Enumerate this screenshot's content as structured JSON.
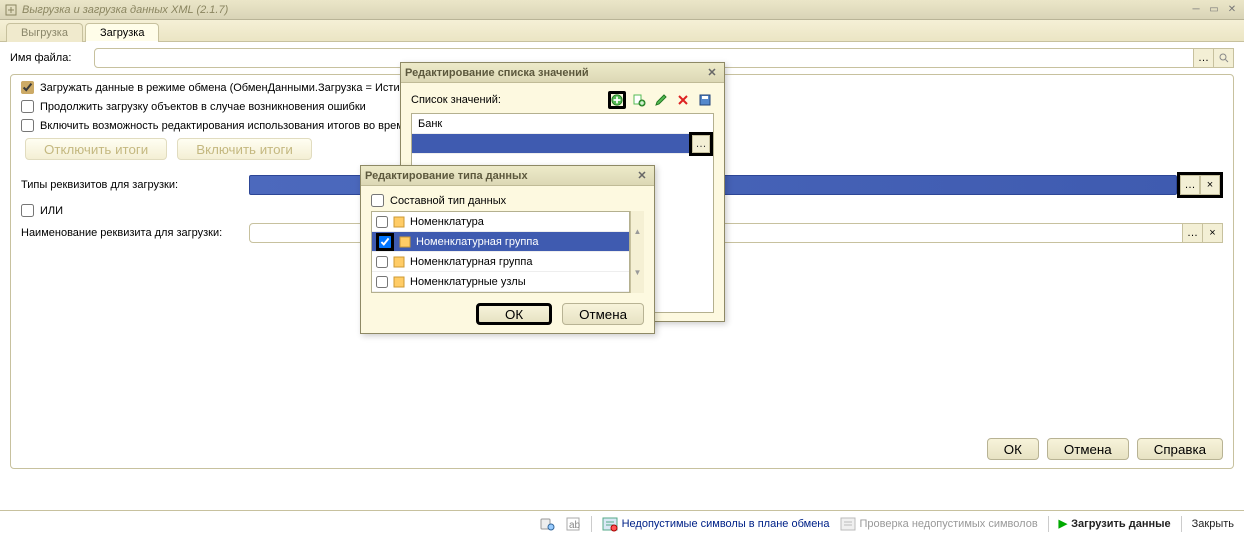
{
  "window": {
    "title": "Выгрузка и загрузка данных XML (2.1.7)"
  },
  "tabs": {
    "export": "Выгрузка",
    "import": "Загрузка"
  },
  "fields": {
    "filename_label": "Имя файла:",
    "req_types_label": "Типы реквизитов для загрузки:",
    "req_name_label": "Наименование реквизита для загрузки:"
  },
  "checkboxes": {
    "exchange_mode": "Загружать данные в режиме обмена (ОбменДанными.Загрузка = Истина)",
    "continue_on_error": "Продолжить загрузку объектов в случае возникновения ошибки",
    "enable_totals_edit": "Включить возможность редактирования использования итогов во время выгрузки",
    "or_label": "ИЛИ"
  },
  "buttons": {
    "disable_totals": "Отключить итоги",
    "enable_totals": "Включить итоги",
    "ok": "ОК",
    "cancel": "Отмена",
    "help": "Справка",
    "close": "Закрыть"
  },
  "statusbar": {
    "invalid_chars": "Недопустимые символы в плане обмена",
    "check_invalid": "Проверка недопустимых символов",
    "upload_data": "Загрузить данные"
  },
  "dialog1": {
    "title": "Редактирование списка значений",
    "list_label": "Список значений:",
    "items": [
      "Банк"
    ]
  },
  "dialog2": {
    "title": "Редактирование типа данных",
    "composite_label": "Составной тип данных",
    "types": [
      {
        "name": "Номенклатура",
        "checked": false,
        "selected": false
      },
      {
        "name": "Номенклатурная группа",
        "checked": true,
        "selected": true
      },
      {
        "name": "Номенклатурная группа",
        "checked": false,
        "selected": false
      },
      {
        "name": "Номенклатурные узлы",
        "checked": false,
        "selected": false
      }
    ]
  },
  "icons": {
    "ellipsis": "…",
    "clear": "×",
    "search": "🔍"
  }
}
